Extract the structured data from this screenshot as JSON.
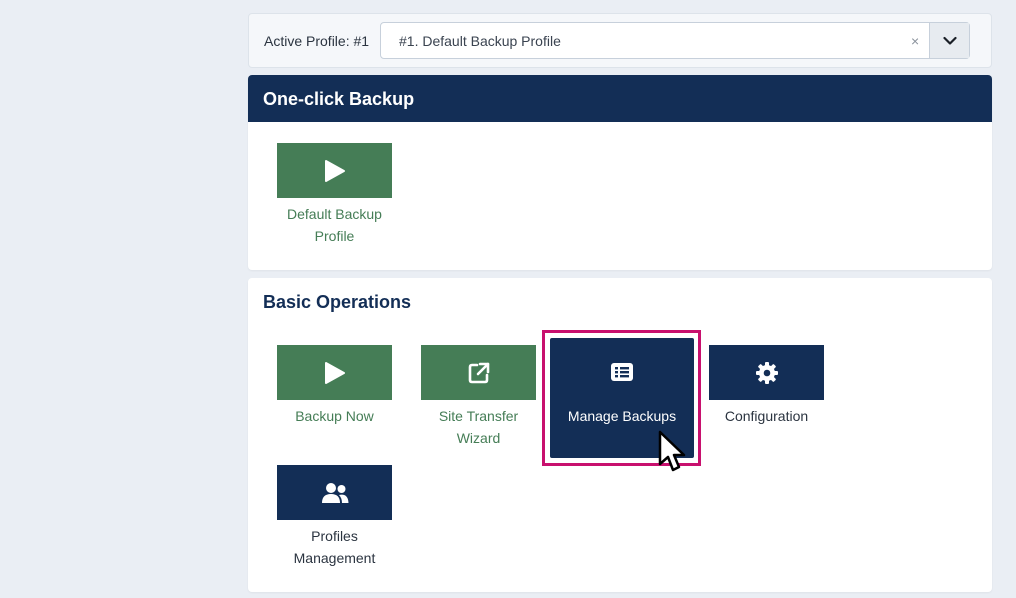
{
  "profile": {
    "label": "Active Profile: #1",
    "selected": "#1. Default Backup Profile",
    "clear_symbol": "×",
    "caret_icon": "chevron-down-icon"
  },
  "one_click": {
    "title": "One-click Backup",
    "tiles": [
      {
        "label": "Default Backup Profile",
        "icon": "play-icon",
        "color": "#457d56"
      }
    ]
  },
  "basic": {
    "title": "Basic Operations",
    "tiles": [
      {
        "label": "Backup Now",
        "icon": "play-icon",
        "color": "#457d56"
      },
      {
        "label": "Site Transfer Wizard",
        "icon": "external-link-icon",
        "color": "#457d56"
      },
      {
        "label": "Manage Backups",
        "icon": "list-icon",
        "color": "#132e56"
      },
      {
        "label": "Configuration",
        "icon": "gear-icon",
        "color": "#132e56"
      },
      {
        "label": "Profiles Management",
        "icon": "users-icon",
        "color": "#132e56"
      }
    ]
  },
  "colors": {
    "navy": "#132e56",
    "green": "#457d56",
    "highlight": "#c8106e",
    "background": "#eaeef4"
  }
}
